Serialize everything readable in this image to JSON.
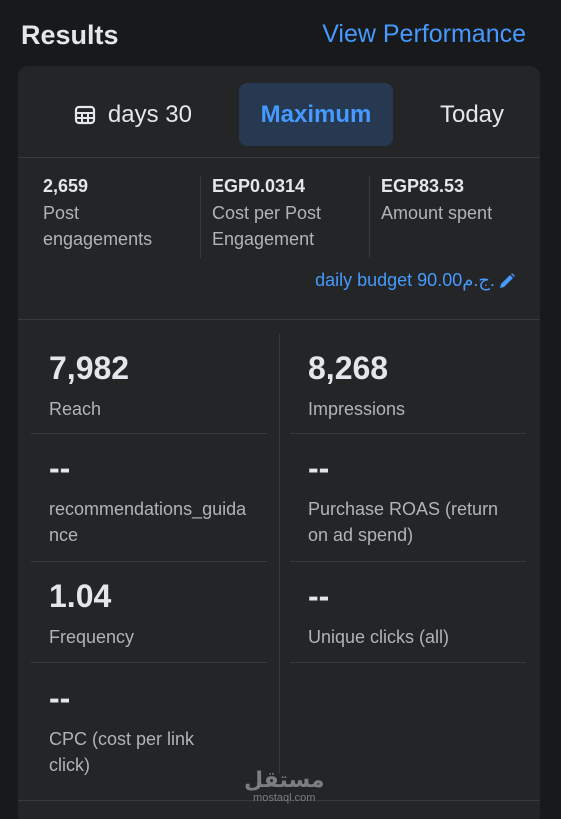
{
  "header": {
    "title": "Results",
    "view_performance": "View Performance"
  },
  "tabs": [
    {
      "label": "30 days"
    },
    {
      "label": "Maximum",
      "selected": true
    },
    {
      "label": "Today"
    }
  ],
  "summary": [
    {
      "value": "2,659",
      "label": "Post engagements"
    },
    {
      "value": "EGP0.0314",
      "label": "Cost per Post Engagement"
    },
    {
      "value": "EGP83.53",
      "label": "Amount spent"
    }
  ],
  "budget": {
    "label": "daily budget 90.00ج.م."
  },
  "metrics": [
    {
      "value": "7,982",
      "label": "Reach"
    },
    {
      "value": "8,268",
      "label": "Impressions"
    },
    {
      "value": "--",
      "label": "recommendations_guidance"
    },
    {
      "value": "--",
      "label": "Purchase ROAS (return on ad spend)"
    },
    {
      "value": "1.04",
      "label": "Frequency"
    },
    {
      "value": "--",
      "label": "Unique clicks (all)"
    },
    {
      "value": "--",
      "label": "CPC (cost per link click)"
    }
  ],
  "watermark": {
    "arabic": "مستقل",
    "domain": "mostaql.com"
  },
  "colors": {
    "accent": "#4599ff",
    "background": "#18191a",
    "card": "#242526",
    "selected_tab": "#263951"
  }
}
